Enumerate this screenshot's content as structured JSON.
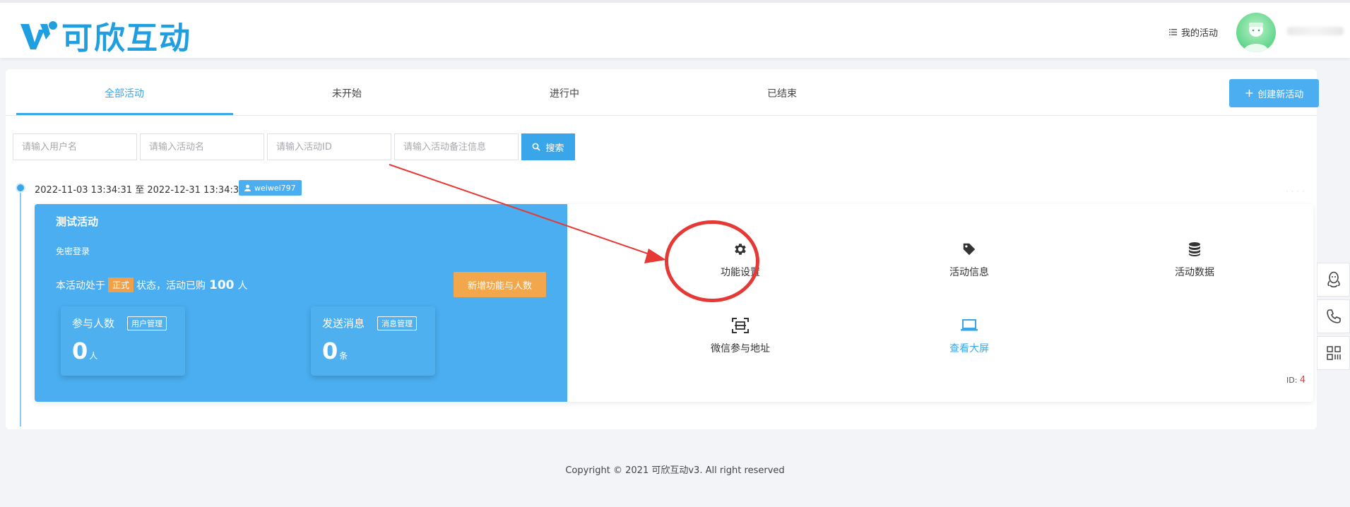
{
  "brand": {
    "name": "可欣互动",
    "color": "#1f9ee0"
  },
  "header": {
    "my_activities": "我的活动",
    "avatar_icon": "avatar-icon"
  },
  "tabs": [
    {
      "label": "全部活动",
      "active": true
    },
    {
      "label": "未开始",
      "active": false
    },
    {
      "label": "进行中",
      "active": false
    },
    {
      "label": "已结束",
      "active": false
    }
  ],
  "create_button": {
    "label": "创建新活动",
    "icon": "plus-icon"
  },
  "filters": {
    "username_placeholder": "请输入用户名",
    "activity_name_placeholder": "请输入活动名",
    "activity_id_placeholder": "请输入活动ID",
    "note_placeholder": "请输入活动备注信息",
    "search_label": "搜索"
  },
  "activity": {
    "date_range": "2022-11-03 13:34:31 至 2022-12-31 13:34:31",
    "user": "weiwei797",
    "title": "测试活动",
    "login_mode": "免密登录",
    "status_prefix": "本活动处于",
    "status_badge": "正式",
    "status_mid": "状态，活动已购",
    "purchased": "100",
    "status_unit": "人",
    "new_func_button": "新增功能与人数",
    "participants": {
      "label": "参与人数",
      "manage": "用户管理",
      "value": "0",
      "unit": "人"
    },
    "messages": {
      "label": "发送消息",
      "manage": "消息管理",
      "value": "0",
      "unit": "条"
    },
    "functions": {
      "settings": "功能设置",
      "info": "活动信息",
      "data": "活动数据",
      "wechat_url": "微信参与地址",
      "big_screen": "查看大屏"
    },
    "id_label": "ID:",
    "id_value": "4"
  },
  "annotation_color": "#e53935",
  "footer": {
    "copyright": "Copyright © 2021 可欣互动v3. All right reserved"
  },
  "float_bar": [
    "qq-icon",
    "phone-icon",
    "qrcode-icon"
  ]
}
